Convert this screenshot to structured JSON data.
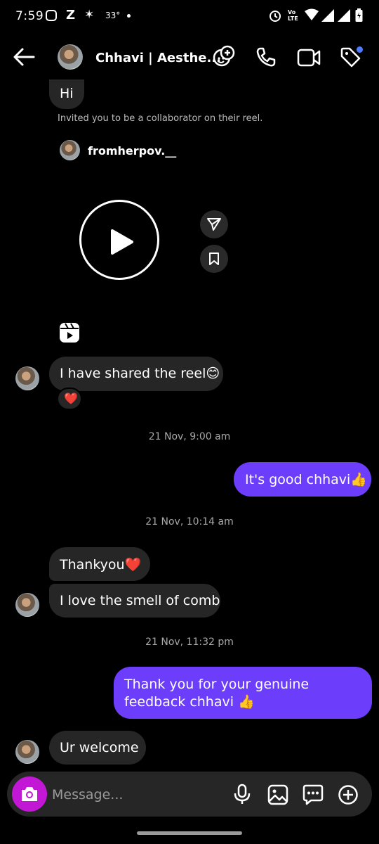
{
  "status_bar": {
    "time": "7:59",
    "temperature": "33°",
    "volte": "Vo LTE"
  },
  "header": {
    "contact_name": "Chhavi | Aesthe..."
  },
  "messages": {
    "hi": "Hi",
    "collab_note": "Invited you to be a collaborator on their reel.",
    "reel_owner": "fromherpov.__",
    "shared_reel": "I have shared the reel😊",
    "reaction": "❤️",
    "ts1": "21 Nov, 9:00 am",
    "good": "It's good chhavi👍",
    "ts2": "21 Nov, 10:14 am",
    "thankyou": "Thankyou❤️",
    "comb": "I love the smell of comb",
    "ts3": "21 Nov, 11:32 pm",
    "feedback": "Thank you for your genuine feedback chhavi 👍",
    "welcome": "Ur welcome"
  },
  "composer": {
    "placeholder": "Message..."
  },
  "colors": {
    "outgoing_bubble": "#6c3dfa",
    "incoming_bubble": "#262626",
    "camera_button": "#c218d6",
    "notification_dot": "#4f7cff"
  }
}
